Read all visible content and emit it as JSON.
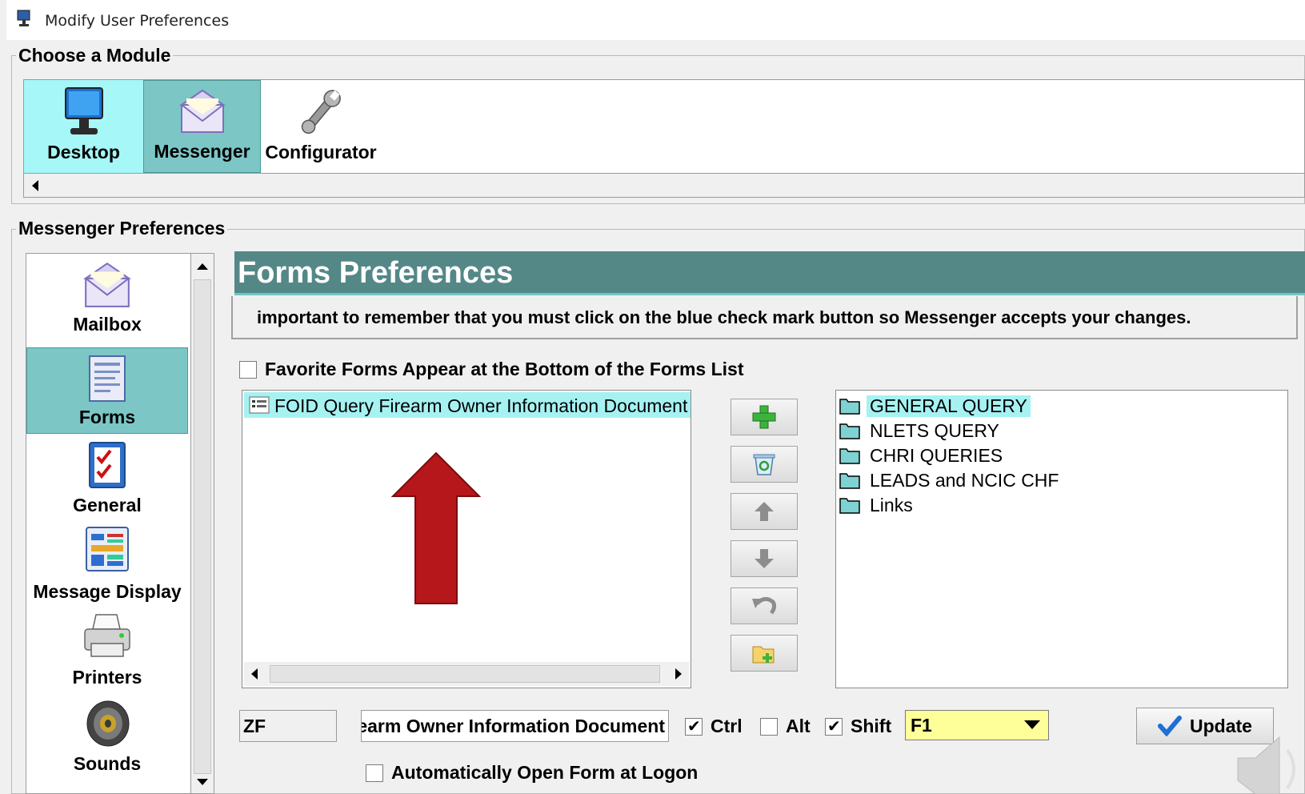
{
  "window": {
    "title": "Modify User Preferences"
  },
  "module_group": {
    "label": "Choose a Module",
    "modules": [
      {
        "label": "Desktop",
        "icon": "monitor-icon"
      },
      {
        "label": "Messenger",
        "icon": "envelope-icon"
      },
      {
        "label": "Configurator",
        "icon": "wrench-icon"
      }
    ]
  },
  "prefs_group": {
    "label": "Messenger Preferences",
    "nav": [
      {
        "label": "Mailbox",
        "icon": "envelope-icon"
      },
      {
        "label": "Forms",
        "icon": "document-icon"
      },
      {
        "label": "General",
        "icon": "checklist-icon"
      },
      {
        "label": "Message Display",
        "icon": "layout-icon"
      },
      {
        "label": "Printers",
        "icon": "printer-icon"
      },
      {
        "label": "Sounds",
        "icon": "speaker-icon"
      }
    ]
  },
  "forms": {
    "header": "Forms Preferences",
    "description": "important to remember that you must click on the blue check mark button so Messenger accepts your changes.",
    "favorites_bottom_label": "Favorite Forms Appear at the Bottom of the Forms List",
    "selected_forms": [
      "FOID Query Firearm Owner Information Document"
    ],
    "folders": [
      "GENERAL QUERY",
      "NLETS QUERY",
      "CHRI QUERIES",
      "LEADS and NCIC CHF",
      "Links"
    ],
    "shortcut_code": "ZF",
    "form_name": "FOID Query Firearm Owner Information Document",
    "ctrl_label": "Ctrl",
    "alt_label": "Alt",
    "shift_label": "Shift",
    "key": "F1",
    "update_label": "Update",
    "auto_open_label": "Automatically Open Form at Logon",
    "modifiers": {
      "ctrl": true,
      "alt": false,
      "shift": true
    },
    "accent_color": "#548887",
    "highlight_color": "#a6f2f2"
  }
}
